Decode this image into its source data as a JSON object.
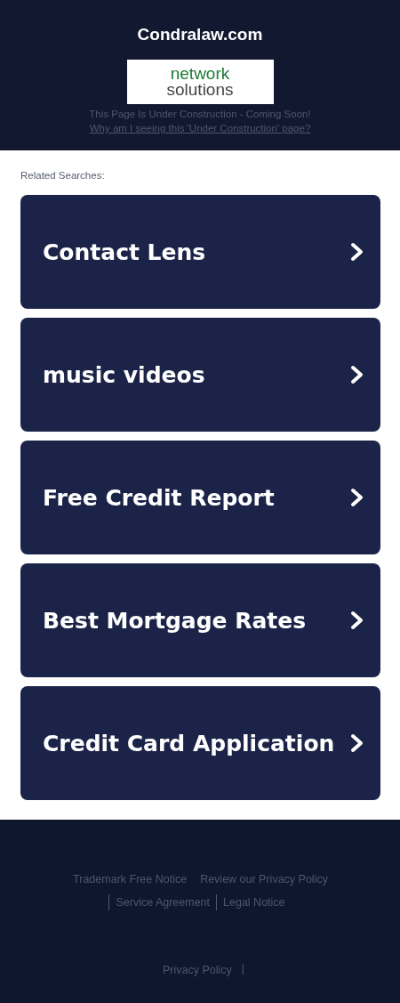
{
  "header": {
    "title": "Condralaw.com",
    "logo": {
      "line_1": "network",
      "line_2": "solutions"
    },
    "notice": "This Page Is Under Construction - Coming Soon!",
    "notice_link": "Why am I seeing this 'Under Construction' page?"
  },
  "related": {
    "heading": "Related Searches:",
    "items": [
      {
        "label": "Contact Lens"
      },
      {
        "label": "music videos"
      },
      {
        "label": "Free Credit Report"
      },
      {
        "label": "Best Mortgage Rates"
      },
      {
        "label": "Credit Card Application"
      }
    ]
  },
  "footer": {
    "links": [
      {
        "label": "Trademark Free Notice",
        "divider_before": false
      },
      {
        "label": "Review our Privacy Policy",
        "divider_before": false
      },
      {
        "label": "Service Agreement",
        "divider_before": true
      },
      {
        "label": "Legal Notice",
        "divider_before": true
      }
    ],
    "bottom_link": "Privacy Policy",
    "bottom_separator": "|"
  }
}
